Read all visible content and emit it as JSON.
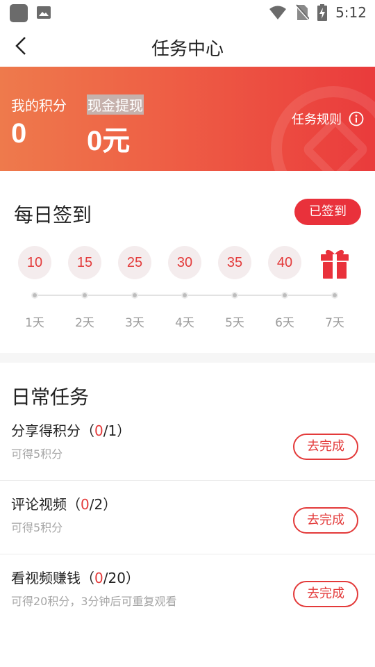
{
  "status_bar": {
    "time": "5:12"
  },
  "header": {
    "title": "任务中心"
  },
  "banner": {
    "points_label": "我的积分",
    "points_value": "0",
    "cash_label": "现金提现",
    "cash_value": "0元",
    "rules_label": "任务规则"
  },
  "checkin": {
    "title": "每日签到",
    "status_label": "已签到",
    "days": [
      {
        "reward": "10",
        "label": "1天"
      },
      {
        "reward": "15",
        "label": "2天"
      },
      {
        "reward": "25",
        "label": "3天"
      },
      {
        "reward": "30",
        "label": "4天"
      },
      {
        "reward": "35",
        "label": "5天"
      },
      {
        "reward": "40",
        "label": "6天"
      },
      {
        "reward": "gift",
        "label": "7天"
      }
    ]
  },
  "tasks": {
    "title": "日常任务",
    "items": [
      {
        "name": "分享得积分",
        "done": "0",
        "total": "1",
        "desc": "可得5积分",
        "button": "去完成"
      },
      {
        "name": "评论视频",
        "done": "0",
        "total": "2",
        "desc": "可得5积分",
        "button": "去完成"
      },
      {
        "name": "看视频赚钱",
        "done": "0",
        "total": "20",
        "desc": "可得20积分，3分钟后可重复观看",
        "button": "去完成"
      }
    ]
  },
  "colors": {
    "accent": "#e33a3a",
    "banner_start": "#ee7a4c",
    "banner_end": "#ea3b3c"
  }
}
